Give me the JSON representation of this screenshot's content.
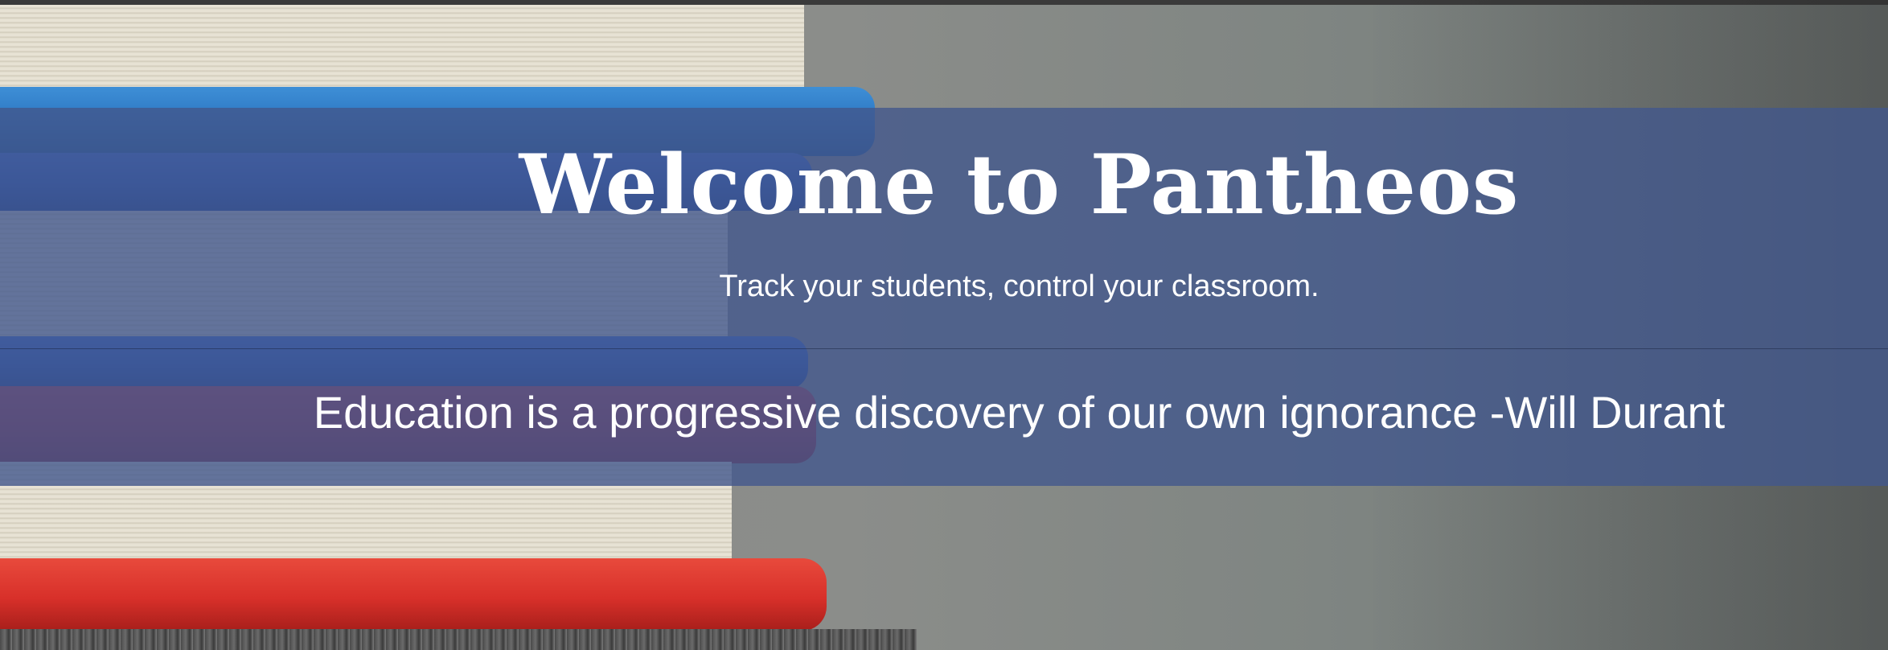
{
  "hero": {
    "title": "Welcome to Pantheos",
    "subtitle": "Track your students, control your classroom.",
    "quote": "Education is a progressive discovery of our own ignorance -Will Durant"
  },
  "colors": {
    "overlay": "#42588c",
    "text": "#ffffff"
  }
}
